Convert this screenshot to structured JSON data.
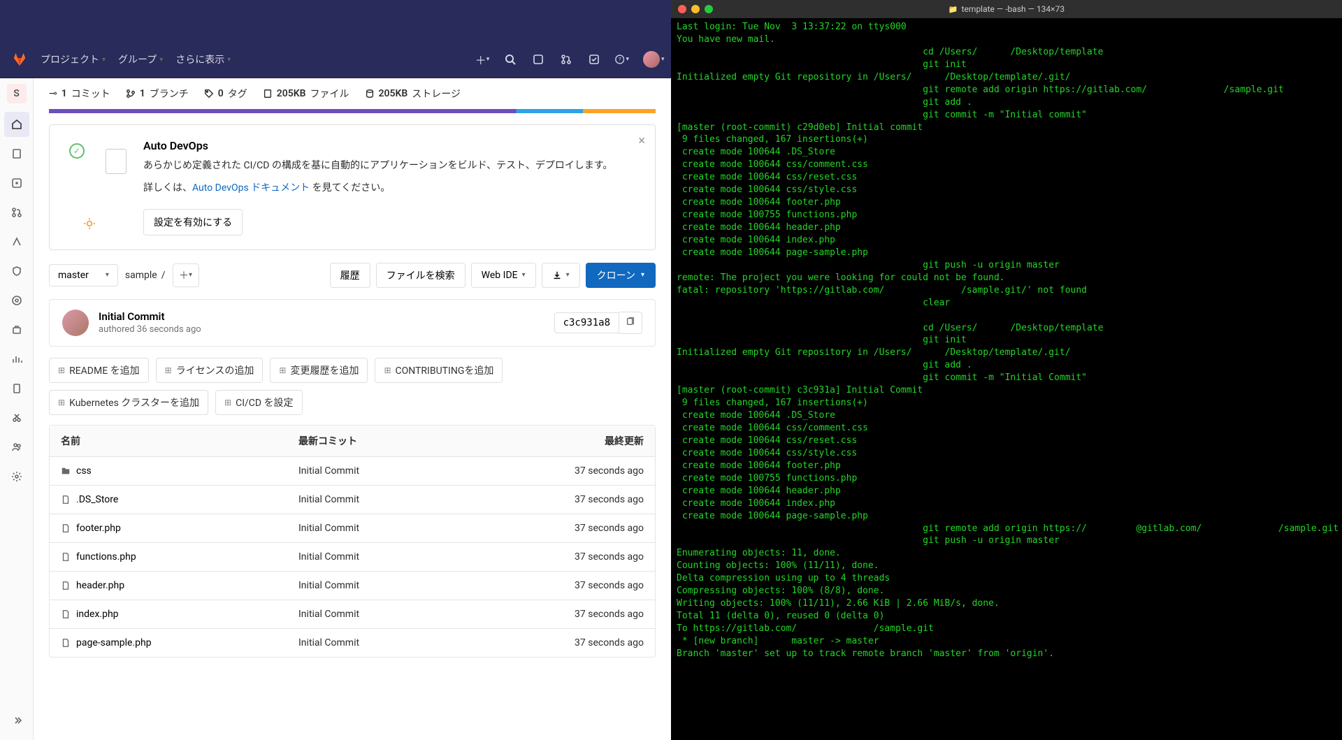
{
  "gitlab": {
    "nav": {
      "projects": "プロジェクト",
      "groups": "グループ",
      "more": "さらに表示"
    },
    "sidebar_badge": "S",
    "stats": {
      "commits_n": "1",
      "commits_l": "コミット",
      "branches_n": "1",
      "branches_l": "ブランチ",
      "tags_n": "0",
      "tags_l": "タグ",
      "files_n": "205KB",
      "files_l": "ファイル",
      "storage_n": "205KB",
      "storage_l": "ストレージ"
    },
    "devops": {
      "title": "Auto DevOps",
      "desc": "あらかじめ定義された CI/CD の構成を基に自動的にアプリケーションをビルド、テスト、デプロイします。",
      "more_pre": "詳しくは、",
      "more_link": "Auto DevOps ドキュメント",
      "more_post": " を見てください。",
      "enable_btn": "設定を有効にする"
    },
    "toolbar": {
      "branch": "master",
      "crumb": "sample",
      "history": "履歴",
      "find": "ファイルを検索",
      "webide": "Web IDE",
      "clone": "クローン"
    },
    "commit": {
      "title": "Initial Commit",
      "sub": "authored 36 seconds ago",
      "sha": "c3c931a8"
    },
    "chips": [
      "README を追加",
      "ライセンスの追加",
      "変更履歴を追加",
      "CONTRIBUTINGを追加",
      "Kubernetes クラスターを追加",
      "CI/CD を設定"
    ],
    "table": {
      "h_name": "名前",
      "h_commit": "最新コミット",
      "h_date": "最終更新",
      "rows": [
        {
          "icon": "folder",
          "name": "css",
          "commit": "Initial Commit",
          "date": "37 seconds ago"
        },
        {
          "icon": "file",
          "name": ".DS_Store",
          "commit": "Initial Commit",
          "date": "37 seconds ago"
        },
        {
          "icon": "file",
          "name": "footer.php",
          "commit": "Initial Commit",
          "date": "37 seconds ago"
        },
        {
          "icon": "file",
          "name": "functions.php",
          "commit": "Initial Commit",
          "date": "37 seconds ago"
        },
        {
          "icon": "file",
          "name": "header.php",
          "commit": "Initial Commit",
          "date": "37 seconds ago"
        },
        {
          "icon": "file",
          "name": "index.php",
          "commit": "Initial Commit",
          "date": "37 seconds ago"
        },
        {
          "icon": "file",
          "name": "page-sample.php",
          "commit": "Initial Commit",
          "date": "37 seconds ago"
        }
      ]
    }
  },
  "terminal": {
    "title": "template — -bash — 134×73",
    "lines": "Last login: Tue Nov  3 13:37:22 on ttys000\nYou have new mail.\n                                             cd /Users/      /Desktop/template\n                                             git init\nInitialized empty Git repository in /Users/      /Desktop/template/.git/\n                                             git remote add origin https://gitlab.com/              /sample.git\n                                             git add .\n                                             git commit -m \"Initial commit\"\n[master (root-commit) c29d0eb] Initial commit\n 9 files changed, 167 insertions(+)\n create mode 100644 .DS_Store\n create mode 100644 css/comment.css\n create mode 100644 css/reset.css\n create mode 100644 css/style.css\n create mode 100644 footer.php\n create mode 100755 functions.php\n create mode 100644 header.php\n create mode 100644 index.php\n create mode 100644 page-sample.php\n                                             git push -u origin master\nremote: The project you were looking for could not be found.\nfatal: repository 'https://gitlab.com/              /sample.git/' not found\n                                             clear\n\n                                             cd /Users/      /Desktop/template\n                                             git init\nInitialized empty Git repository in /Users/      /Desktop/template/.git/\n                                             git add .\n                                             git commit -m \"Initial Commit\"\n[master (root-commit) c3c931a] Initial Commit\n 9 files changed, 167 insertions(+)\n create mode 100644 .DS_Store\n create mode 100644 css/comment.css\n create mode 100644 css/reset.css\n create mode 100644 css/style.css\n create mode 100644 footer.php\n create mode 100755 functions.php\n create mode 100644 header.php\n create mode 100644 index.php\n create mode 100644 page-sample.php\n                                             git remote add origin https://         @gitlab.com/              /sample.git\n                                             git push -u origin master\nEnumerating objects: 11, done.\nCounting objects: 100% (11/11), done.\nDelta compression using up to 4 threads\nCompressing objects: 100% (8/8), done.\nWriting objects: 100% (11/11), 2.66 KiB | 2.66 MiB/s, done.\nTotal 11 (delta 0), reused 0 (delta 0)\nTo https://gitlab.com/              /sample.git\n * [new branch]      master -> master\nBranch 'master' set up to track remote branch 'master' from 'origin'.\n"
  }
}
